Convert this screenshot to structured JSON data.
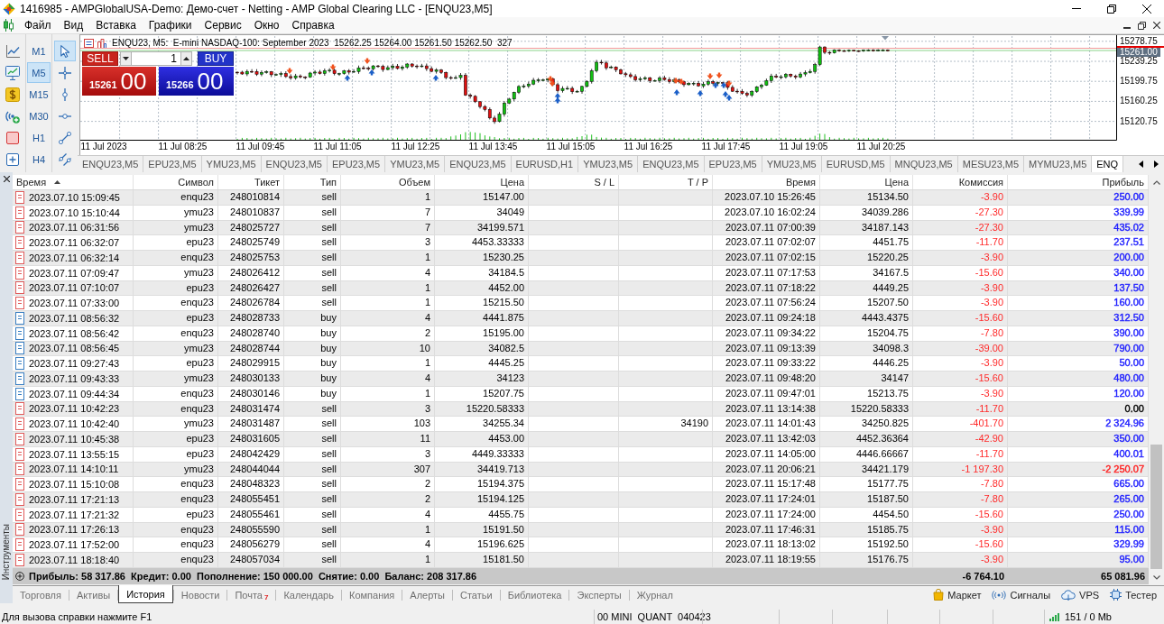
{
  "window": {
    "title": "1416985 - AMPGlobalUSA-Demo: Демо-счет - Netting - AMP Global Clearing LLC - [ENQU23,M5]"
  },
  "menu": [
    "Файл",
    "Вид",
    "Вставка",
    "Графики",
    "Сервис",
    "Окно",
    "Справка"
  ],
  "toolbar": {
    "timeframes": [
      {
        "label": "M1",
        "selected": false
      },
      {
        "label": "M5",
        "selected": true
      },
      {
        "label": "M15",
        "selected": false
      },
      {
        "label": "M30",
        "selected": false
      },
      {
        "label": "H1",
        "selected": false
      },
      {
        "label": "H4",
        "selected": false
      }
    ],
    "tools": [
      {
        "kind": "cursor",
        "selected": true
      },
      {
        "kind": "crosshair",
        "selected": false
      },
      {
        "kind": "vertical-line",
        "selected": false
      },
      {
        "kind": "horizontal-line",
        "selected": false
      },
      {
        "kind": "trend-line",
        "selected": false
      },
      {
        "kind": "channel",
        "selected": false
      }
    ]
  },
  "chart": {
    "header": "ENQU23, M5:  E-mini NASDAQ-100: September 2023  15262.25 15264.00 15261.50 15262.50  327",
    "trade_panel": {
      "sell": "SELL",
      "buy": "BUY",
      "volume": "1",
      "bid": "15261",
      "bid_points": "00",
      "ask": "15266",
      "ask_points": "00"
    },
    "price_labels": [
      "15278.75",
      "15239.25",
      "15199.75",
      "15160.25",
      "15120.75"
    ],
    "current_price": "15261.00",
    "time_labels": [
      "11 Jul 2023",
      "11 Jul 08:25",
      "11 Jul 09:45",
      "11 Jul 11:05",
      "11 Jul 12:25",
      "11 Jul 13:45",
      "11 Jul 15:05",
      "11 Jul 16:25",
      "11 Jul 17:45",
      "11 Jul 19:05",
      "11 Jul 20:25"
    ]
  },
  "chart_tabs": [
    {
      "label": "ENQU23,M5",
      "selected": false
    },
    {
      "label": "EPU23,M5",
      "selected": false
    },
    {
      "label": "YMU23,M5",
      "selected": false
    },
    {
      "label": "ENQU23,M5",
      "selected": false
    },
    {
      "label": "EPU23,M5",
      "selected": false
    },
    {
      "label": "YMU23,M5",
      "selected": false
    },
    {
      "label": "ENQU23,M5",
      "selected": false
    },
    {
      "label": "EURUSD,H1",
      "selected": false
    },
    {
      "label": "YMU23,M5",
      "selected": false
    },
    {
      "label": "ENQU23,M5",
      "selected": false
    },
    {
      "label": "EPU23,M5",
      "selected": false
    },
    {
      "label": "YMU23,M5",
      "selected": false
    },
    {
      "label": "EURUSD,M5",
      "selected": false
    },
    {
      "label": "MNQU23,M5",
      "selected": false
    },
    {
      "label": "MESU23,M5",
      "selected": false
    },
    {
      "label": "MYMU23,M5",
      "selected": false
    },
    {
      "label": "ENQ",
      "selected": true
    }
  ],
  "toolbox": {
    "side_label": "Инструменты",
    "columns": [
      {
        "label": "Время",
        "sorted": true
      },
      {
        "label": "Символ",
        "sorted": false
      },
      {
        "label": "Тикет",
        "sorted": false
      },
      {
        "label": "Тип",
        "sorted": false
      },
      {
        "label": "Объем",
        "sorted": false
      },
      {
        "label": "Цена",
        "sorted": false
      },
      {
        "label": "S / L",
        "sorted": false
      },
      {
        "label": "T / P",
        "sorted": false
      },
      {
        "label": "Время",
        "sorted": false
      },
      {
        "label": "Цена",
        "sorted": false
      },
      {
        "label": "Комиссия",
        "sorted": false
      },
      {
        "label": "Прибыль",
        "sorted": false
      }
    ],
    "rows": [
      {
        "time": "2023.07.10 15:09:45",
        "symbol": "enqu23",
        "ticket": "248010814",
        "type": "sell",
        "volume": "1",
        "price": "15147.00",
        "time_2": "2023.07.10 15:26:45",
        "price_2": "15134.50",
        "commission": "-3.90",
        "profit": {
          "text": "250.00",
          "color": "#2020ff"
        },
        "color": "#e05a5a"
      },
      {
        "time": "2023.07.10 15:10:44",
        "symbol": "ymu23",
        "ticket": "248010837",
        "type": "sell",
        "volume": "7",
        "price": "34049",
        "time_2": "2023.07.10 16:02:24",
        "price_2": "34039.286",
        "commission": "-27.30",
        "profit": {
          "text": "339.99",
          "color": "#2020ff"
        },
        "color": "#e05a5a"
      },
      {
        "time": "2023.07.11 06:31:56",
        "symbol": "ymu23",
        "ticket": "248025727",
        "type": "sell",
        "volume": "7",
        "price": "34199.571",
        "time_2": "2023.07.11 07:00:39",
        "price_2": "34187.143",
        "commission": "-27.30",
        "profit": {
          "text": "435.02",
          "color": "#2020ff"
        },
        "color": "#e05a5a"
      },
      {
        "time": "2023.07.11 06:32:07",
        "symbol": "epu23",
        "ticket": "248025749",
        "type": "sell",
        "volume": "3",
        "price": "4453.33333",
        "time_2": "2023.07.11 07:02:07",
        "price_2": "4451.75",
        "commission": "-11.70",
        "profit": {
          "text": "237.51",
          "color": "#2020ff"
        },
        "color": "#e05a5a"
      },
      {
        "time": "2023.07.11 06:32:14",
        "symbol": "enqu23",
        "ticket": "248025753",
        "type": "sell",
        "volume": "1",
        "price": "15230.25",
        "time_2": "2023.07.11 07:02:15",
        "price_2": "15220.25",
        "commission": "-3.90",
        "profit": {
          "text": "200.00",
          "color": "#2020ff"
        },
        "color": "#e05a5a"
      },
      {
        "time": "2023.07.11 07:09:47",
        "symbol": "ymu23",
        "ticket": "248026412",
        "type": "sell",
        "volume": "4",
        "price": "34184.5",
        "time_2": "2023.07.11 07:17:53",
        "price_2": "34167.5",
        "commission": "-15.60",
        "profit": {
          "text": "340.00",
          "color": "#2020ff"
        },
        "color": "#e05a5a"
      },
      {
        "time": "2023.07.11 07:10:07",
        "symbol": "epu23",
        "ticket": "248026427",
        "type": "sell",
        "volume": "1",
        "price": "4452.00",
        "time_2": "2023.07.11 07:18:22",
        "price_2": "4449.25",
        "commission": "-3.90",
        "profit": {
          "text": "137.50",
          "color": "#2020ff"
        },
        "color": "#e05a5a"
      },
      {
        "time": "2023.07.11 07:33:00",
        "symbol": "enqu23",
        "ticket": "248026784",
        "type": "sell",
        "volume": "1",
        "price": "15215.50",
        "time_2": "2023.07.11 07:56:24",
        "price_2": "15207.50",
        "commission": "-3.90",
        "profit": {
          "text": "160.00",
          "color": "#2020ff"
        },
        "color": "#e05a5a"
      },
      {
        "time": "2023.07.11 08:56:32",
        "symbol": "epu23",
        "ticket": "248028733",
        "type": "buy",
        "volume": "4",
        "price": "4441.875",
        "time_2": "2023.07.11 09:24:18",
        "price_2": "4443.4375",
        "commission": "-15.60",
        "profit": {
          "text": "312.50",
          "color": "#2020ff"
        },
        "color": "#3a7fc2"
      },
      {
        "time": "2023.07.11 08:56:42",
        "symbol": "enqu23",
        "ticket": "248028740",
        "type": "buy",
        "volume": "2",
        "price": "15195.00",
        "time_2": "2023.07.11 09:34:22",
        "price_2": "15204.75",
        "commission": "-7.80",
        "profit": {
          "text": "390.00",
          "color": "#2020ff"
        },
        "color": "#3a7fc2"
      },
      {
        "time": "2023.07.11 08:56:45",
        "symbol": "ymu23",
        "ticket": "248028744",
        "type": "buy",
        "volume": "10",
        "price": "34082.5",
        "time_2": "2023.07.11 09:13:39",
        "price_2": "34098.3",
        "commission": "-39.00",
        "profit": {
          "text": "790.00",
          "color": "#2020ff"
        },
        "color": "#3a7fc2"
      },
      {
        "time": "2023.07.11 09:27:43",
        "symbol": "epu23",
        "ticket": "248029915",
        "type": "buy",
        "volume": "1",
        "price": "4445.25",
        "time_2": "2023.07.11 09:33:22",
        "price_2": "4446.25",
        "commission": "-3.90",
        "profit": {
          "text": "50.00",
          "color": "#2020ff"
        },
        "color": "#3a7fc2"
      },
      {
        "time": "2023.07.11 09:43:33",
        "symbol": "ymu23",
        "ticket": "248030133",
        "type": "buy",
        "volume": "4",
        "price": "34123",
        "time_2": "2023.07.11 09:48:20",
        "price_2": "34147",
        "commission": "-15.60",
        "profit": {
          "text": "480.00",
          "color": "#2020ff"
        },
        "color": "#3a7fc2"
      },
      {
        "time": "2023.07.11 09:44:34",
        "symbol": "enqu23",
        "ticket": "248030146",
        "type": "buy",
        "volume": "1",
        "price": "15207.75",
        "time_2": "2023.07.11 09:47:01",
        "price_2": "15213.75",
        "commission": "-3.90",
        "profit": {
          "text": "120.00",
          "color": "#2020ff"
        },
        "color": "#3a7fc2"
      },
      {
        "time": "2023.07.11 10:42:23",
        "symbol": "enqu23",
        "ticket": "248031474",
        "type": "sell",
        "volume": "3",
        "price": "15220.58333",
        "time_2": "2023.07.11 13:14:38",
        "price_2": "15220.58333",
        "commission": "-11.70",
        "profit": {
          "text": "0.00",
          "color": "#000000"
        },
        "color": "#e05a5a"
      },
      {
        "time": "2023.07.11 10:42:40",
        "symbol": "ymu23",
        "ticket": "248031487",
        "type": "sell",
        "volume": "103",
        "price": "34255.34",
        "tp": "34190",
        "time_2": "2023.07.11 14:01:43",
        "price_2": "34250.825",
        "commission": "-401.70",
        "profit": {
          "text": "2 324.96",
          "color": "#2020ff"
        },
        "color": "#e05a5a"
      },
      {
        "time": "2023.07.11 10:45:38",
        "symbol": "epu23",
        "ticket": "248031605",
        "type": "sell",
        "volume": "11",
        "price": "4453.00",
        "time_2": "2023.07.11 13:42:03",
        "price_2": "4452.36364",
        "commission": "-42.90",
        "profit": {
          "text": "350.00",
          "color": "#2020ff"
        },
        "color": "#e05a5a"
      },
      {
        "time": "2023.07.11 13:55:15",
        "symbol": "epu23",
        "ticket": "248042429",
        "type": "sell",
        "volume": "3",
        "price": "4449.33333",
        "time_2": "2023.07.11 14:05:00",
        "price_2": "4446.66667",
        "commission": "-11.70",
        "profit": {
          "text": "400.01",
          "color": "#2020ff"
        },
        "color": "#e05a5a"
      },
      {
        "time": "2023.07.11 14:10:11",
        "symbol": "ymu23",
        "ticket": "248044044",
        "type": "sell",
        "volume": "307",
        "price": "34419.713",
        "time_2": "2023.07.11 20:06:21",
        "price_2": "34421.179",
        "commission": "-1 197.30",
        "profit": {
          "text": "-2 250.07",
          "color": "#ff2020"
        },
        "color": "#e05a5a"
      },
      {
        "time": "2023.07.11 15:10:08",
        "symbol": "enqu23",
        "ticket": "248048323",
        "type": "sell",
        "volume": "2",
        "price": "15194.375",
        "time_2": "2023.07.11 15:17:48",
        "price_2": "15177.75",
        "commission": "-7.80",
        "profit": {
          "text": "665.00",
          "color": "#2020ff"
        },
        "color": "#e05a5a"
      },
      {
        "time": "2023.07.11 17:21:13",
        "symbol": "enqu23",
        "ticket": "248055451",
        "type": "sell",
        "volume": "2",
        "price": "15194.125",
        "time_2": "2023.07.11 17:24:01",
        "price_2": "15187.50",
        "commission": "-7.80",
        "profit": {
          "text": "265.00",
          "color": "#2020ff"
        },
        "color": "#e05a5a"
      },
      {
        "time": "2023.07.11 17:21:32",
        "symbol": "epu23",
        "ticket": "248055461",
        "type": "sell",
        "volume": "4",
        "price": "4455.75",
        "time_2": "2023.07.11 17:24:00",
        "price_2": "4454.50",
        "commission": "-15.60",
        "profit": {
          "text": "250.00",
          "color": "#2020ff"
        },
        "color": "#e05a5a"
      },
      {
        "time": "2023.07.11 17:26:13",
        "symbol": "enqu23",
        "ticket": "248055590",
        "type": "sell",
        "volume": "1",
        "price": "15191.50",
        "time_2": "2023.07.11 17:46:31",
        "price_2": "15185.75",
        "commission": "-3.90",
        "profit": {
          "text": "115.00",
          "color": "#2020ff"
        },
        "color": "#e05a5a"
      },
      {
        "time": "2023.07.11 17:52:00",
        "symbol": "enqu23",
        "ticket": "248056279",
        "type": "sell",
        "volume": "4",
        "price": "15196.625",
        "time_2": "2023.07.11 18:13:02",
        "price_2": "15192.50",
        "commission": "-15.60",
        "profit": {
          "text": "329.99",
          "color": "#2020ff"
        },
        "color": "#e05a5a"
      },
      {
        "time": "2023.07.11 18:18:40",
        "symbol": "enqu23",
        "ticket": "248057034",
        "type": "sell",
        "volume": "1",
        "price": "15181.50",
        "time_2": "2023.07.11 18:19:55",
        "price_2": "15176.75",
        "commission": "-3.90",
        "profit": {
          "text": "95.00",
          "color": "#2020ff"
        },
        "color": "#e05a5a"
      }
    ],
    "summary": {
      "text": "Прибыль: 58 317.86  Кредит: 0.00  Пополнение: 150 000.00  Снятие: 0.00  Баланс: 208 317.86",
      "commission": "-6 764.10",
      "profit": "65 081.96"
    },
    "tabs": [
      {
        "label": "Торговля",
        "selected": false
      },
      {
        "label": "Активы",
        "selected": false
      },
      {
        "label": "История",
        "selected": true
      },
      {
        "label": "Новости",
        "selected": false
      },
      {
        "label": "Почта",
        "selected": false,
        "badge": "7"
      },
      {
        "label": "Календарь",
        "selected": false
      },
      {
        "label": "Компания",
        "selected": false
      },
      {
        "label": "Алерты",
        "selected": false
      },
      {
        "label": "Статьи",
        "selected": false
      },
      {
        "label": "Библиотека",
        "selected": false
      },
      {
        "label": "Эксперты",
        "selected": false
      },
      {
        "label": "Журнал",
        "selected": false
      }
    ],
    "services": [
      {
        "kind": "market",
        "label": "Маркет"
      },
      {
        "kind": "signals",
        "label": "Сигналы"
      },
      {
        "kind": "vps",
        "label": "VPS"
      },
      {
        "kind": "tester",
        "label": "Тестер"
      }
    ]
  },
  "status_bar": {
    "help": "Для вызова справки нажмите F1",
    "profile": "00 MINI  QUANT  040423",
    "traffic": "151 / 0 Mb"
  }
}
